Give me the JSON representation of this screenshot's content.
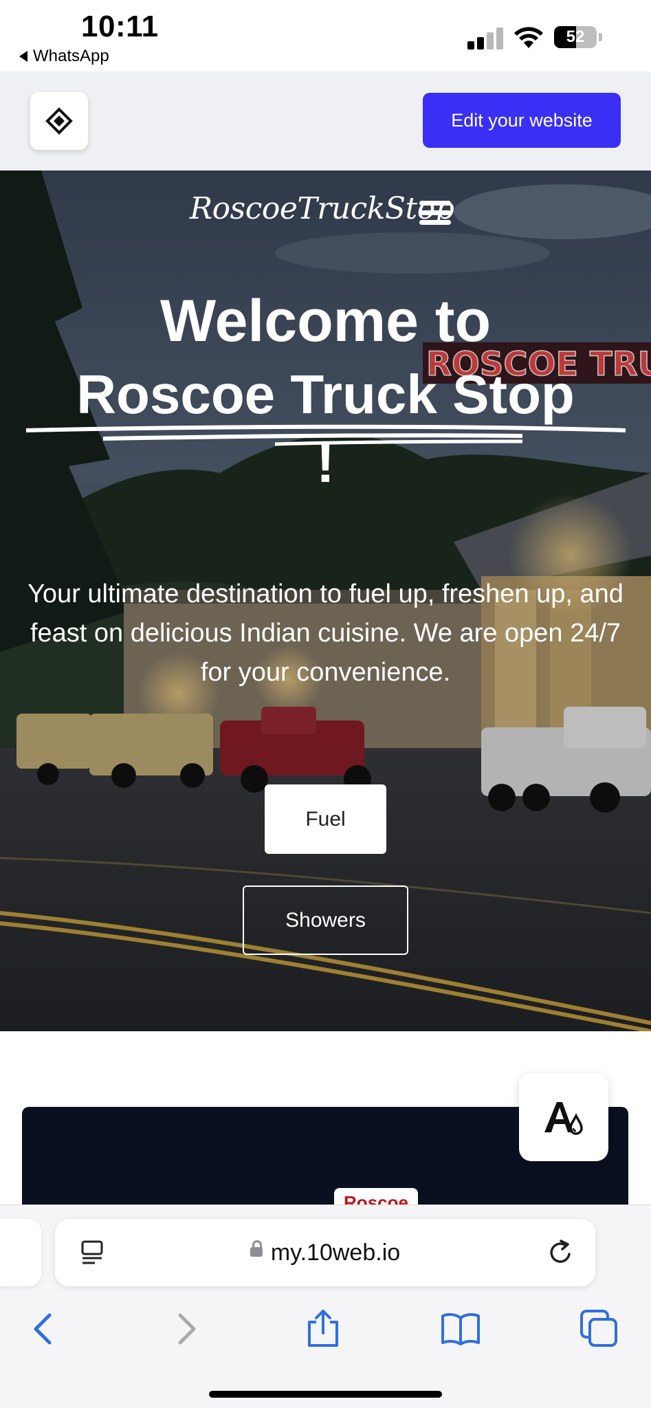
{
  "status_bar": {
    "time": "10:11",
    "back_app": "WhatsApp",
    "battery_level": "52",
    "battery_fraction": 0.52
  },
  "editor_bar": {
    "logo_icon": "diamond-logo-icon",
    "edit_button_label": "Edit your website",
    "accent_color": "#3a2ff5"
  },
  "hero": {
    "brand": "RoscoeTruckStop",
    "menu_icon": "hamburger-icon",
    "headline_line1": "Welcome to",
    "headline_line2": "Roscoe Truck Stop",
    "headline_line3": "!",
    "sign_text": "ROSCOE TRUCK",
    "tagline": "Your ultimate destination to fuel up, freshen up, and feast on delicious Indian cuisine. We are open 24/7 for your convenience.",
    "buttons": {
      "fuel": "Fuel",
      "showers": "Showers"
    }
  },
  "below_fold": {
    "sign_peek": "Roscoe",
    "accessibility_icon": "accessibility-font-icon"
  },
  "browser": {
    "url": "my.10web.io",
    "icons": [
      "page-menu-icon",
      "lock-icon",
      "reload-icon",
      "back-icon",
      "forward-icon",
      "share-icon",
      "bookmarks-icon",
      "tabs-icon"
    ]
  }
}
